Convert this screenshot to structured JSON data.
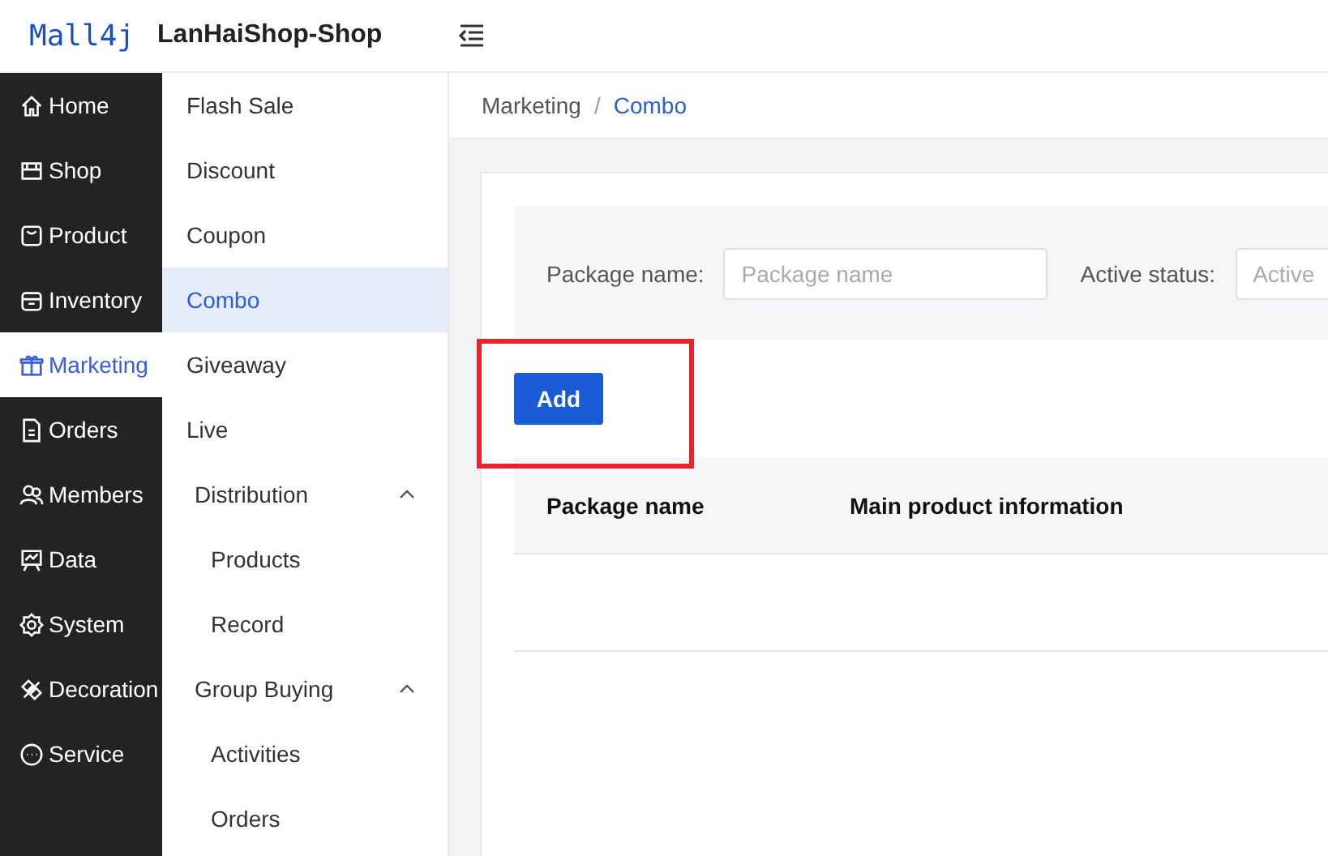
{
  "header": {
    "logo": "Mall4j",
    "title": "LanHaiShop-Shop"
  },
  "main_nav": [
    {
      "label": "Home",
      "selected": false
    },
    {
      "label": "Shop",
      "selected": false
    },
    {
      "label": "Product",
      "selected": false
    },
    {
      "label": "Inventory",
      "selected": false
    },
    {
      "label": "Marketing",
      "selected": true
    },
    {
      "label": "Orders",
      "selected": false
    },
    {
      "label": "Members",
      "selected": false
    },
    {
      "label": "Data",
      "selected": false
    },
    {
      "label": "System",
      "selected": false
    },
    {
      "label": "Decoration",
      "selected": false
    },
    {
      "label": "Service",
      "selected": false
    }
  ],
  "sub_nav": [
    {
      "label": "Flash Sale",
      "selected": false
    },
    {
      "label": "Discount",
      "selected": false
    },
    {
      "label": "Coupon",
      "selected": false
    },
    {
      "label": "Combo",
      "selected": true
    },
    {
      "label": "Giveaway",
      "selected": false
    },
    {
      "label": "Live",
      "selected": false
    },
    {
      "label": "Distribution",
      "expanded": true,
      "children": [
        {
          "label": "Products",
          "selected": false
        },
        {
          "label": "Record",
          "selected": false
        }
      ]
    },
    {
      "label": "Group Buying",
      "expanded": true,
      "children": [
        {
          "label": "Activities",
          "selected": false
        },
        {
          "label": "Orders",
          "selected": false
        }
      ]
    }
  ],
  "breadcrumb": [
    {
      "label": "Marketing",
      "current": false
    },
    {
      "label": "Combo",
      "current": true
    }
  ],
  "breadcrumb_separator": "/",
  "search": [
    {
      "label": "Package name:",
      "placeholder": "Package name"
    },
    {
      "label": "Active status:",
      "placeholder": "Active"
    }
  ],
  "add_button": {
    "label": "Add",
    "highlighted": true
  },
  "table": {
    "columns": [
      "Package name",
      "Main product information"
    ]
  }
}
